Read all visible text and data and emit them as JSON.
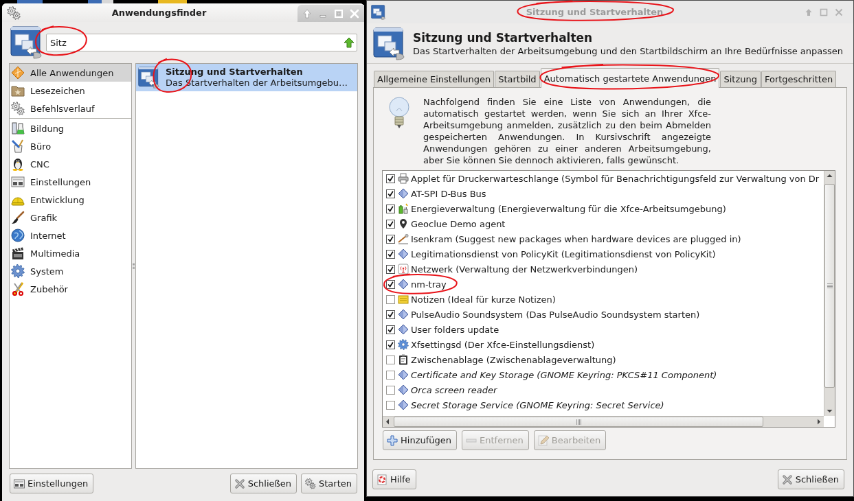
{
  "finder_window": {
    "titlebar": {
      "title": "Anwendungsfinder",
      "active": true
    },
    "search": {
      "value": "Sitz",
      "circled": true
    },
    "places": [
      {
        "label": "Alle Anwendungen",
        "kind": "all",
        "selected": true
      },
      {
        "label": "Lesezeichen",
        "kind": "bookmarks",
        "selected": false
      },
      {
        "label": "Befehlsverlauf",
        "kind": "history",
        "selected": false
      }
    ],
    "categories": [
      {
        "label": "Bildung",
        "kind": "education",
        "selected": false
      },
      {
        "label": "Büro",
        "kind": "office",
        "selected": false
      },
      {
        "label": "CNC",
        "kind": "cnc",
        "selected": false
      },
      {
        "label": "Einstellungen",
        "kind": "settings",
        "selected": false
      },
      {
        "label": "Entwicklung",
        "kind": "development",
        "selected": false
      },
      {
        "label": "Grafik",
        "kind": "graphics",
        "selected": false
      },
      {
        "label": "Internet",
        "kind": "internet",
        "selected": false
      },
      {
        "label": "Multimedia",
        "kind": "multimedia",
        "selected": false
      },
      {
        "label": "System",
        "kind": "system",
        "selected": false
      },
      {
        "label": "Zubehör",
        "kind": "accessories",
        "selected": false
      }
    ],
    "results": [
      {
        "title": "Sitzung und Startverhalten",
        "description": "Das Startverhalten der Arbeitsumgebu…",
        "selected": true,
        "circled": true
      }
    ],
    "buttons": [
      {
        "label": "Einstellungen",
        "kind": "settings"
      },
      {
        "label": "Schließen",
        "kind": "close"
      },
      {
        "label": "Starten",
        "kind": "launch"
      }
    ]
  },
  "session_window": {
    "titlebar": {
      "title": "Sitzung und Startverhalten",
      "active": false,
      "circled": true
    },
    "header": {
      "title": "Sitzung und Startverhalten",
      "subtitle": "Das Startverhalten der Arbeitsumgebung und den Startbildschirm an Ihre Bedürfnisse anpassen"
    },
    "tabs": [
      {
        "label": "Allgemeine Einstellungen",
        "selected": false,
        "circled": false
      },
      {
        "label": "Startbild",
        "selected": false,
        "circled": false
      },
      {
        "label": "Automatisch gestartete Anwendungen",
        "selected": true,
        "circled": true
      },
      {
        "label": "Sitzung",
        "selected": false,
        "circled": false
      },
      {
        "label": "Fortgeschritten",
        "selected": false,
        "circled": false
      }
    ],
    "info_text": "Nachfolgend finden Sie eine Liste von Anwendungen, die automatisch gestartet werden, wenn Sie sich an Ihrer Xfce-Arbeitsumgebung anmelden, zusätzlich zu den beim Abmelden gespeicherten Anwendungen. In Kursivschrift angezeigte Anwendungen gehören zu einer anderen Arbeitsumgebung, aber Sie können Sie dennoch aktivieren, falls gewünscht.",
    "autostart": [
      {
        "name": "Applet für Druckerwarteschlange (Symbol für Benachrichtigungsfeld zur Verwaltung von Dr",
        "kind": "printer",
        "checked": true,
        "italic": false,
        "circled": false
      },
      {
        "name": "AT-SPI D-Bus Bus",
        "kind": "generic",
        "checked": true,
        "italic": false,
        "circled": false
      },
      {
        "name": "Energieverwaltung (Energieverwaltung für die Xfce-Arbeitsumgebung)",
        "kind": "power",
        "checked": true,
        "italic": false,
        "circled": false
      },
      {
        "name": "Geoclue Demo agent",
        "kind": "location",
        "checked": true,
        "italic": false,
        "circled": false
      },
      {
        "name": "Isenkram (Suggest new packages when hardware devices are plugged in)",
        "kind": "hardware",
        "checked": true,
        "italic": false,
        "circled": false
      },
      {
        "name": "Legitimationsdienst von PolicyKit (Legitimationsdienst von PolicyKit)",
        "kind": "generic",
        "checked": true,
        "italic": false,
        "circled": false
      },
      {
        "name": "Netzwerk (Verwaltung der Netzwerkverbindungen)",
        "kind": "network",
        "checked": true,
        "italic": false,
        "circled": false
      },
      {
        "name": "nm-tray",
        "kind": "generic",
        "checked": true,
        "italic": false,
        "circled": true
      },
      {
        "name": "Notizen (Ideal für kurze Notizen)",
        "kind": "notes",
        "checked": false,
        "italic": false,
        "circled": false
      },
      {
        "name": "PulseAudio Soundsystem (Das PulseAudio Soundsystem starten)",
        "kind": "generic",
        "checked": true,
        "italic": false,
        "circled": false
      },
      {
        "name": "User folders update",
        "kind": "generic",
        "checked": true,
        "italic": false,
        "circled": false
      },
      {
        "name": "Xfsettingsd (Der Xfce-Einstellungsdienst)",
        "kind": "settings",
        "checked": true,
        "italic": false,
        "circled": false
      },
      {
        "name": "Zwischenablage (Zwischenablageverwaltung)",
        "kind": "clipboard",
        "checked": false,
        "italic": false,
        "circled": false
      },
      {
        "name": "Certificate and Key Storage (GNOME Keyring: PKCS#11 Component)",
        "kind": "generic",
        "checked": false,
        "italic": true,
        "circled": false
      },
      {
        "name": "Orca screen reader",
        "kind": "generic",
        "checked": false,
        "italic": true,
        "circled": false
      },
      {
        "name": "Secret Storage Service (GNOME Keyring: Secret Service)",
        "kind": "generic",
        "checked": false,
        "italic": true,
        "circled": false
      }
    ],
    "list_buttons": [
      {
        "label": "Hinzufügen",
        "kind": "add",
        "disabled": false
      },
      {
        "label": "Entfernen",
        "kind": "remove",
        "disabled": true
      },
      {
        "label": "Bearbeiten",
        "kind": "edit",
        "disabled": true
      }
    ],
    "buttons": [
      {
        "label": "Hilfe",
        "kind": "help"
      },
      {
        "label": "Schließen",
        "kind": "close"
      }
    ]
  }
}
